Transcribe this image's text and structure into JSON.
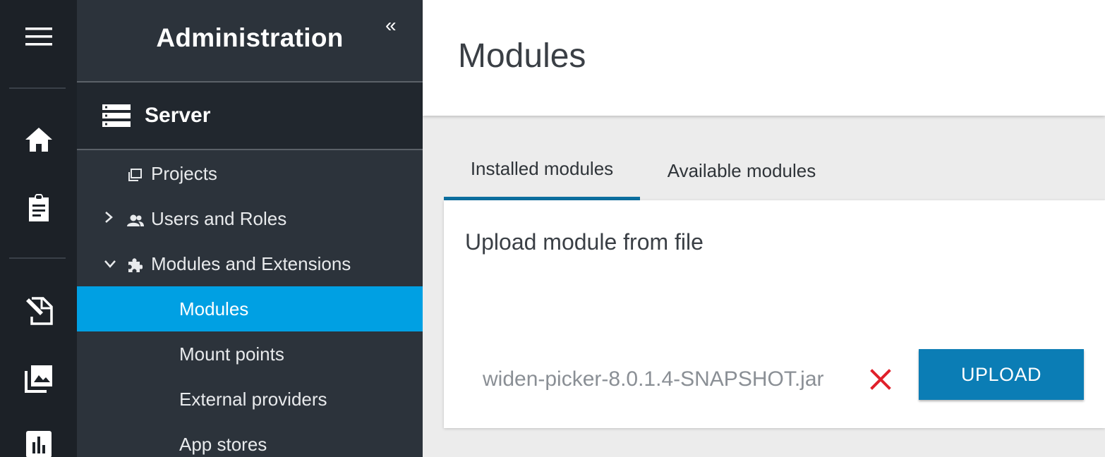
{
  "panel": {
    "title": "Administration",
    "collapse_glyph": "«"
  },
  "server": {
    "label": "Server",
    "icon": "server-icon"
  },
  "nav": {
    "projects": "Projects",
    "users_roles": "Users and Roles",
    "modules_extensions": "Modules and Extensions",
    "modules": "Modules",
    "mount_points": "Mount points",
    "external_providers": "External providers",
    "app_stores": "App stores"
  },
  "rail": [
    "menu-icon",
    "home-icon",
    "clipboard-icon",
    "edit-document-icon",
    "image-library-icon",
    "bar-chart-icon"
  ],
  "header": {
    "title": "Modules"
  },
  "tabs": {
    "installed": "Installed modules",
    "available": "Available modules"
  },
  "upload": {
    "title": "Upload module from file",
    "file_name": "widen-picker-8.0.1.4-SNAPSHOT.jar",
    "button": "UPLOAD"
  },
  "colors": {
    "accent": "#00a0e3",
    "button": "#0b7db5",
    "remove": "#e0202a",
    "rail": "#1c2127",
    "panel": "#2c333b"
  }
}
